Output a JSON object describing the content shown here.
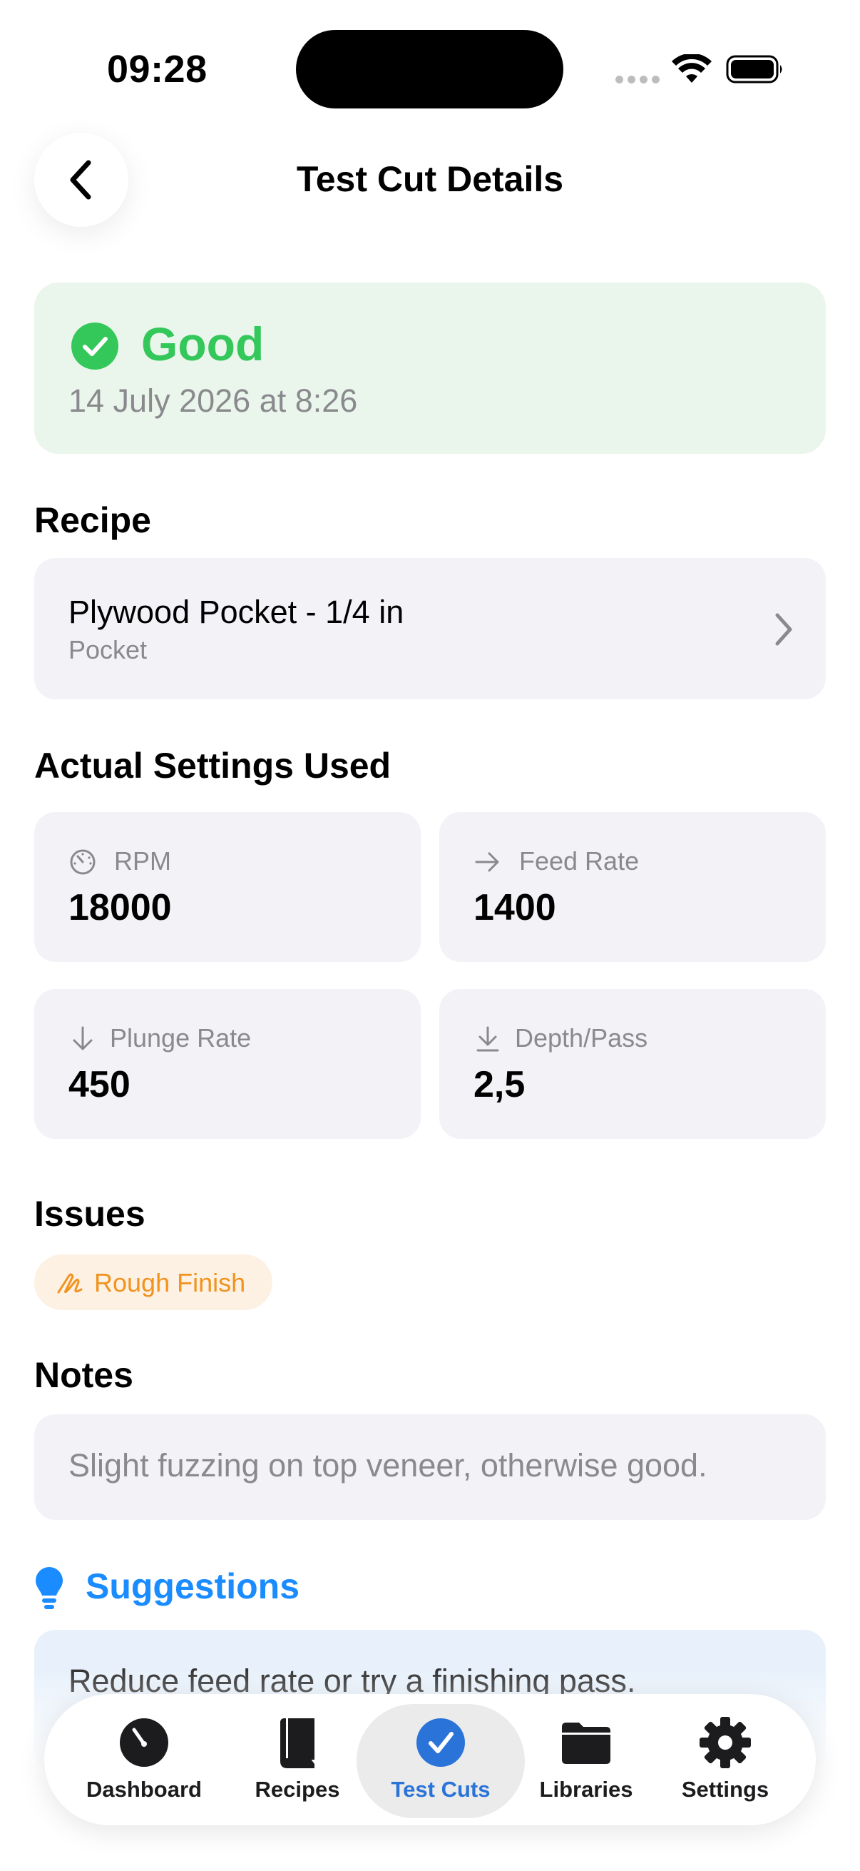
{
  "status_bar": {
    "time": "09:28"
  },
  "nav": {
    "title": "Test Cut Details"
  },
  "result": {
    "label": "Good",
    "date": "14 July 2026 at 8:26",
    "color": "#34c759"
  },
  "recipe": {
    "section_title": "Recipe",
    "name": "Plywood Pocket - 1/4 in",
    "type": "Pocket"
  },
  "settings": {
    "section_title": "Actual Settings Used",
    "items": [
      {
        "icon": "gauge-icon",
        "label": "RPM",
        "value": "18000"
      },
      {
        "icon": "arrow-right-icon",
        "label": "Feed Rate",
        "value": "1400"
      },
      {
        "icon": "arrow-down-icon",
        "label": "Plunge Rate",
        "value": "450"
      },
      {
        "icon": "arrow-down-to-line-icon",
        "label": "Depth/Pass",
        "value": "2,5"
      }
    ]
  },
  "issues": {
    "section_title": "Issues",
    "items": [
      {
        "label": "Rough Finish",
        "icon": "scribble-icon",
        "color": "#f0931f"
      }
    ]
  },
  "notes": {
    "section_title": "Notes",
    "text": "Slight fuzzing on top veneer, otherwise good."
  },
  "suggestions": {
    "section_title": "Suggestions",
    "text": "Reduce feed rate or try a finishing pass.",
    "color": "#1a8cff"
  },
  "tab_bar": {
    "active": "Test Cuts",
    "active_color": "#2a73d9",
    "tabs": [
      {
        "label": "Dashboard",
        "icon": "gauge-icon"
      },
      {
        "label": "Recipes",
        "icon": "book-icon"
      },
      {
        "label": "Test Cuts",
        "icon": "checkmark-circle-icon"
      },
      {
        "label": "Libraries",
        "icon": "folder-icon"
      },
      {
        "label": "Settings",
        "icon": "gear-icon"
      }
    ]
  }
}
